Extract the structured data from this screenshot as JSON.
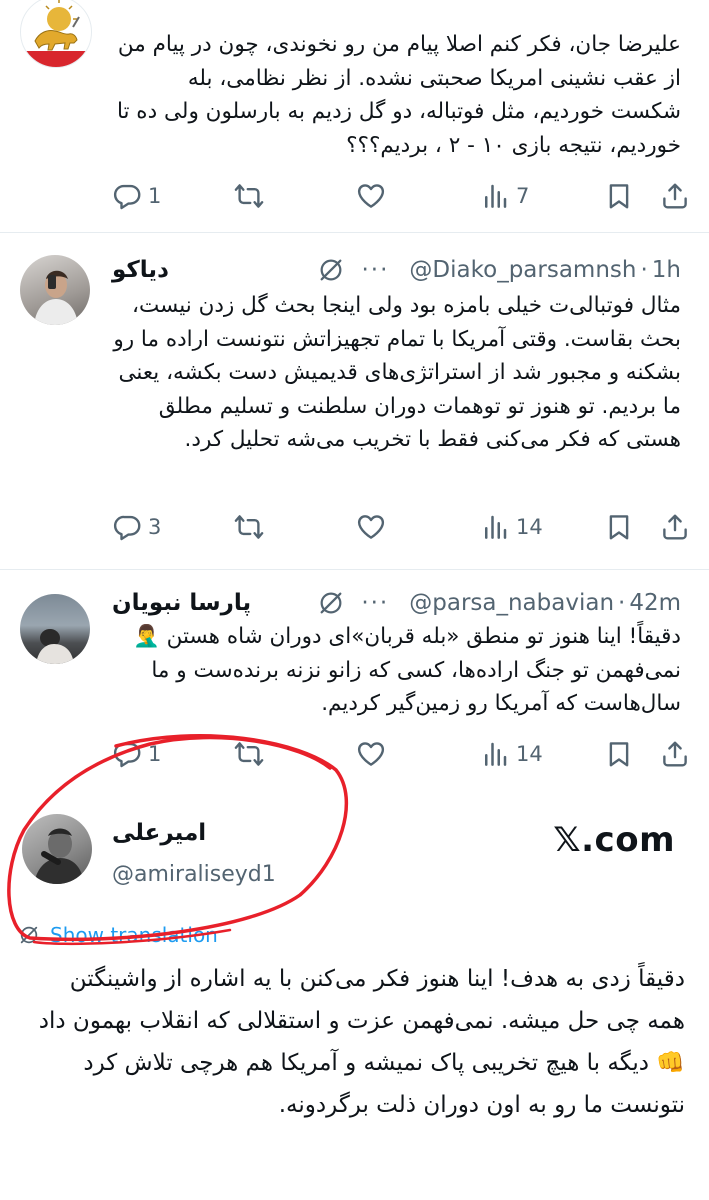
{
  "tweets": [
    {
      "text": "علیرضا جان، فکر کنم اصلا پیام من رو نخوندی، چون در پیام من از عقب نشینی امریکا صحبتی نشده. از نظر نظامی، بله شکست خوردیم، مثل فوتباله، دو گل زدیم به بارسلون ولی ده تا خوردیم، نتیجه بازی ۱۰ - ۲ ، بردیم؟؟؟",
      "replies": "1",
      "views": "7"
    },
    {
      "name": "دیاکو",
      "handle": "@Diako_parsamnsh",
      "time": "1h",
      "text": "مثال فوتبالی‌ت خیلی بامزه بود ولی اینجا بحث گل زدن نیست، بحث بقاست. وقتی آمریکا با تمام تجهیزاتش نتونست اراده ما رو بشکنه و مجبور شد از استراتژی‌های قدیمیش دست بکشه، یعنی ما بردیم. تو هنوز تو توهمات دوران سلطنت و تسلیم مطلق هستی که فکر می‌کنی فقط با تخریب می‌شه تحلیل کرد.",
      "replies": "3",
      "views": "14"
    },
    {
      "name": "پارسا نبویان",
      "handle": "@parsa_nabavian",
      "time": "42m",
      "text": "دقیقاً! اینا هنوز تو منطق «بله قربان»ای دوران شاه هستن 🤦‍♂️ نمی‌فهمن تو جنگ اراده‌ها، کسی که زانو نزنه برنده‌ست و ما سال‌هاست که آمریکا رو زمین‌گیر کردیم.",
      "replies": "1",
      "views": "14"
    }
  ],
  "main": {
    "name": "امیرعلی",
    "handle": "@amiraliseyd1",
    "brand": "𝕏.com",
    "translate": "Show translation",
    "text": "دقیقاً زدی به هدف! اینا هنوز فکر می‌کنن با یه اشاره از واشینگتن همه چی حل میشه. نمی‌فهمن عزت و استقلالی که انقلاب بهمون داد 👊 دیگه با هیچ تخریبی پاک نمیشه و آمریکا هم هرچی تلاش کرد نتونست ما رو به اون دوران ذلت برگردونه."
  },
  "icons": {
    "reply": "reply-icon",
    "repost": "repost-icon",
    "like": "like-icon",
    "views": "views-icon",
    "bookmark": "bookmark-icon",
    "share": "share-icon",
    "grok": "grok-icon",
    "more": "more-icon",
    "translate": "globe-icon"
  },
  "colors": {
    "text": "#0f1419",
    "secondary": "#536471",
    "link": "#1d9bf0",
    "annotation": "#e8202a"
  }
}
